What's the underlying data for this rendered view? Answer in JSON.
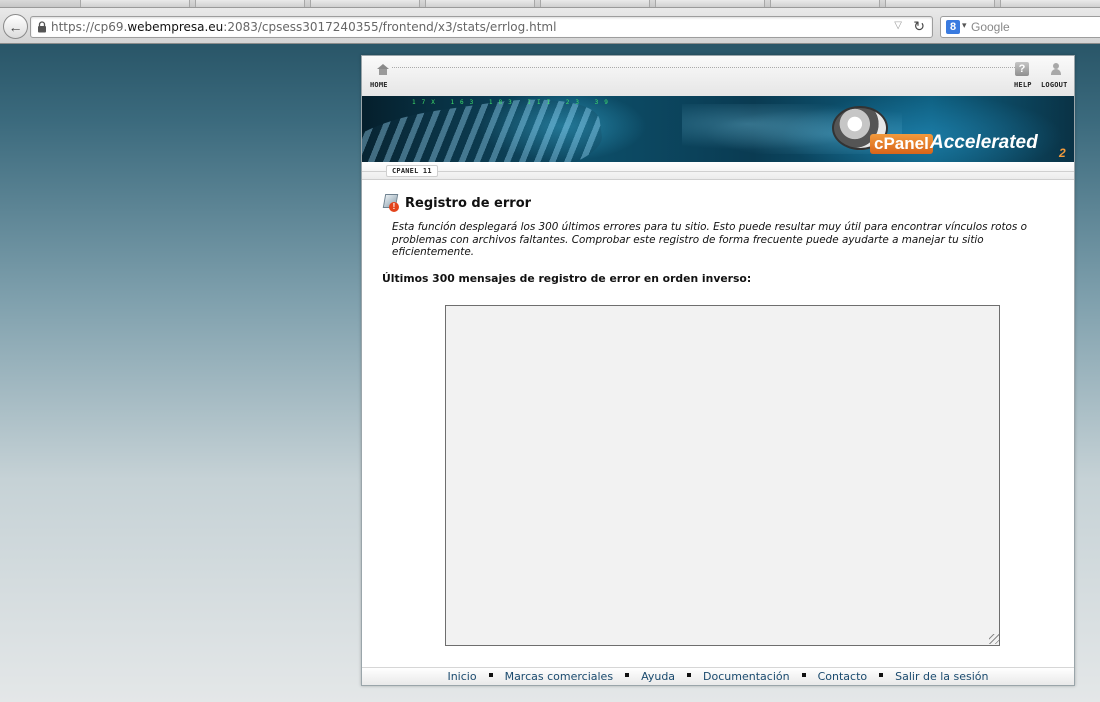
{
  "browser": {
    "url_prefix": "https://cp69.",
    "url_domain": "webempresa.eu",
    "url_path": ":2083/cpsess3017240355/frontend/x3/stats/errlog.html",
    "search_engine": "Google",
    "search_icon_letter": "8"
  },
  "topnav": {
    "home_label": "HOME",
    "help_label": "HELP",
    "logout_label": "LOGOUT"
  },
  "banner": {
    "ticker": "17X  163  183  III  23  39",
    "brand_word": "cPanel",
    "accelerated": "Accelerated",
    "sub": "2"
  },
  "version": "CPANEL 11",
  "page": {
    "title": "Registro de error",
    "description": "Esta función desplegará los 300 últimos errores para tu sitio. Esto puede resultar muy útil para encontrar vínculos rotos o problemas con archivos faltantes. Comprobar este registro de forma frecuente puede ayudarte a manejar tu sitio eficientemente.",
    "log_heading": "Últimos 300 mensajes de registro de error en orden inverso:",
    "log_content": ""
  },
  "footer": {
    "links": [
      "Inicio",
      "Marcas comerciales",
      "Ayuda",
      "Documentación",
      "Contacto",
      "Salir de la sesión"
    ]
  },
  "colors": {
    "brand_orange": "#f29a3c",
    "link_blue": "#1a4a6e",
    "error_red": "#e3431c"
  }
}
